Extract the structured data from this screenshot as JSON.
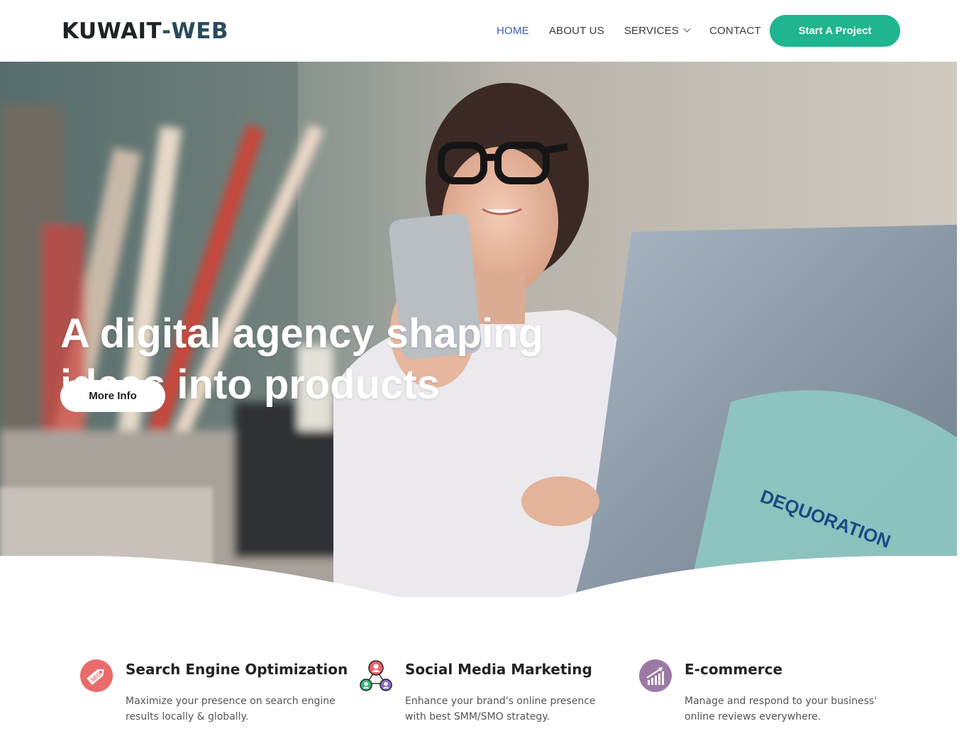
{
  "brand": {
    "part1": "KUWAIT",
    "dash": "-",
    "part2": "WEB"
  },
  "nav": {
    "items": [
      {
        "label": "HOME",
        "active": true
      },
      {
        "label": "ABOUT US",
        "active": false
      },
      {
        "label": "SERVICES",
        "active": false,
        "has_dropdown": true
      },
      {
        "label": "CONTACT",
        "active": false
      }
    ],
    "cta_label": "Start A Project"
  },
  "hero": {
    "line1": "A digital agency shaping",
    "line2": "ideas into products",
    "button_label": "More Info",
    "laptop_sticker_text": "DEQUORATION"
  },
  "services": [
    {
      "title": "Search Engine Optimization",
      "desc": "Maximize your presence on search engine results locally & globally.",
      "icon": "seo-tag-icon",
      "badge": "SEO"
    },
    {
      "title": "Social Media Marketing",
      "desc": "Enhance your brand's online presence with best SMM/SMO strategy.",
      "icon": "social-network-icon"
    },
    {
      "title": "E-commerce",
      "desc": "Manage and respond to your business' online reviews everywhere.",
      "icon": "growth-chart-icon"
    }
  ],
  "colors": {
    "accent": "#1fb58f",
    "nav_active": "#3e5cb8",
    "seo_icon": "#ea6b6b",
    "ecom_icon": "#9b7aa6"
  }
}
